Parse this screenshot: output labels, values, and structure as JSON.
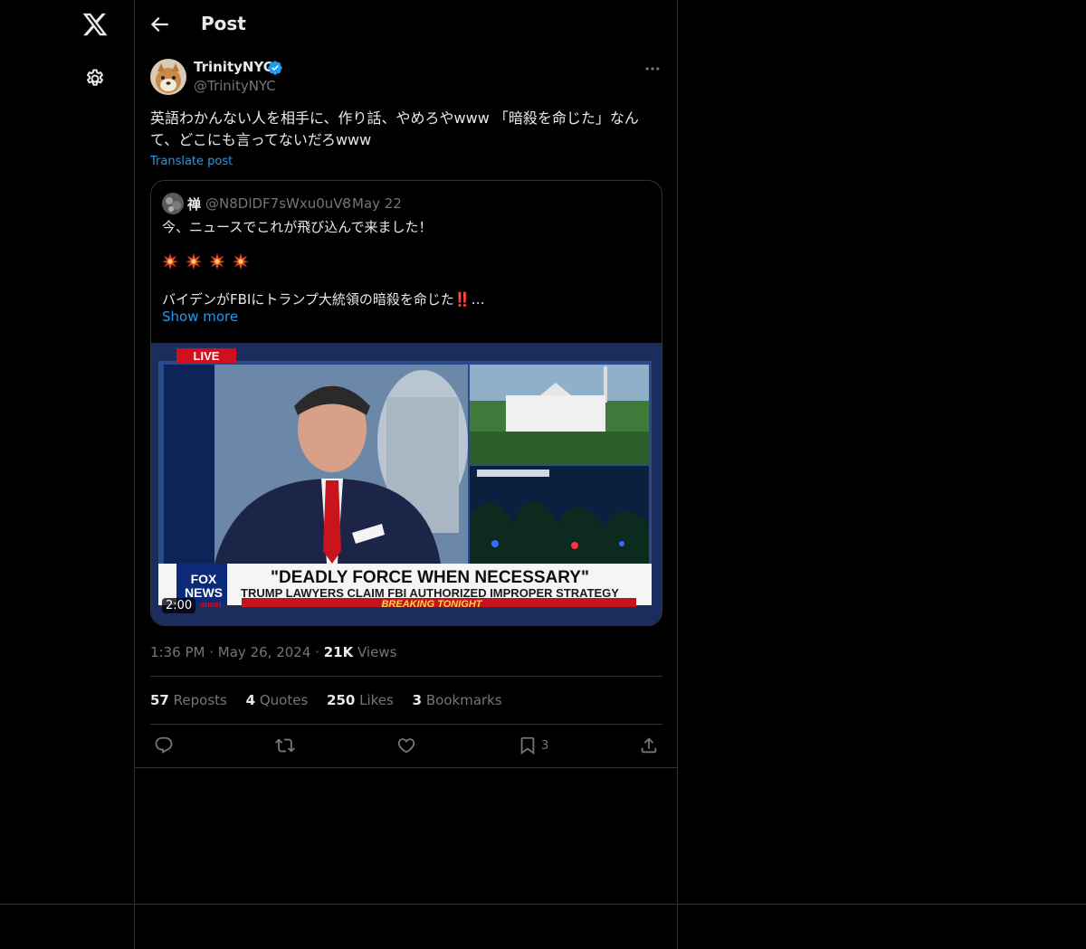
{
  "colors": {
    "background": "#000000",
    "text": "#e7e9ea",
    "muted": "#71767b",
    "accent": "#1d9bf0",
    "border": "#2f3336"
  },
  "nav": {
    "logo_icon": "x-logo-icon",
    "settings_icon": "gear-icon"
  },
  "header": {
    "title": "Post",
    "back_icon": "arrow-left-icon"
  },
  "post": {
    "author": {
      "name": "TrinityNYC",
      "handle": "@TrinityNYC",
      "verified": true
    },
    "text": "英語わかんない人を相手に、作り話、やめろやwww 「暗殺を命じた」なんて、どこにも言ってないだろwww",
    "translate_label": "Translate post",
    "time": "1:36 PM",
    "date": "May 26, 2024",
    "views_count": "21K",
    "views_label": "Views"
  },
  "quote": {
    "author": {
      "name": "禅",
      "handle": "@N8DlDF7sWxu0uV8"
    },
    "separator": "·",
    "date": "May 22",
    "line1": "今、ニュースでこれが飛び込んで来ました！",
    "line3": "バイデンがFBIにトランプ大統領の暗殺を命じた‼️…",
    "show_more": "Show more",
    "video": {
      "duration": "2:00",
      "live_label": "LIVE",
      "headline": "\"DEADLY FORCE WHEN NECESSARY\"",
      "subheadline": "TRUMP LAWYERS CLAIM FBI AUTHORIZED IMPROPER STRATEGY",
      "breaking": "BREAKING TONIGHT",
      "brand_line1": "FOX",
      "brand_line2": "NEWS",
      "brand_line3": "annel"
    }
  },
  "stats": {
    "reposts": {
      "count": "57",
      "label": "Reposts"
    },
    "quotes": {
      "count": "4",
      "label": "Quotes"
    },
    "likes": {
      "count": "250",
      "label": "Likes"
    },
    "bookmarks": {
      "count": "3",
      "label": "Bookmarks"
    }
  },
  "actions": {
    "reply_icon": "reply-icon",
    "repost_icon": "repost-icon",
    "like_icon": "heart-icon",
    "bookmark_icon": "bookmark-icon",
    "bookmark_count": "3",
    "share_icon": "share-icon"
  }
}
